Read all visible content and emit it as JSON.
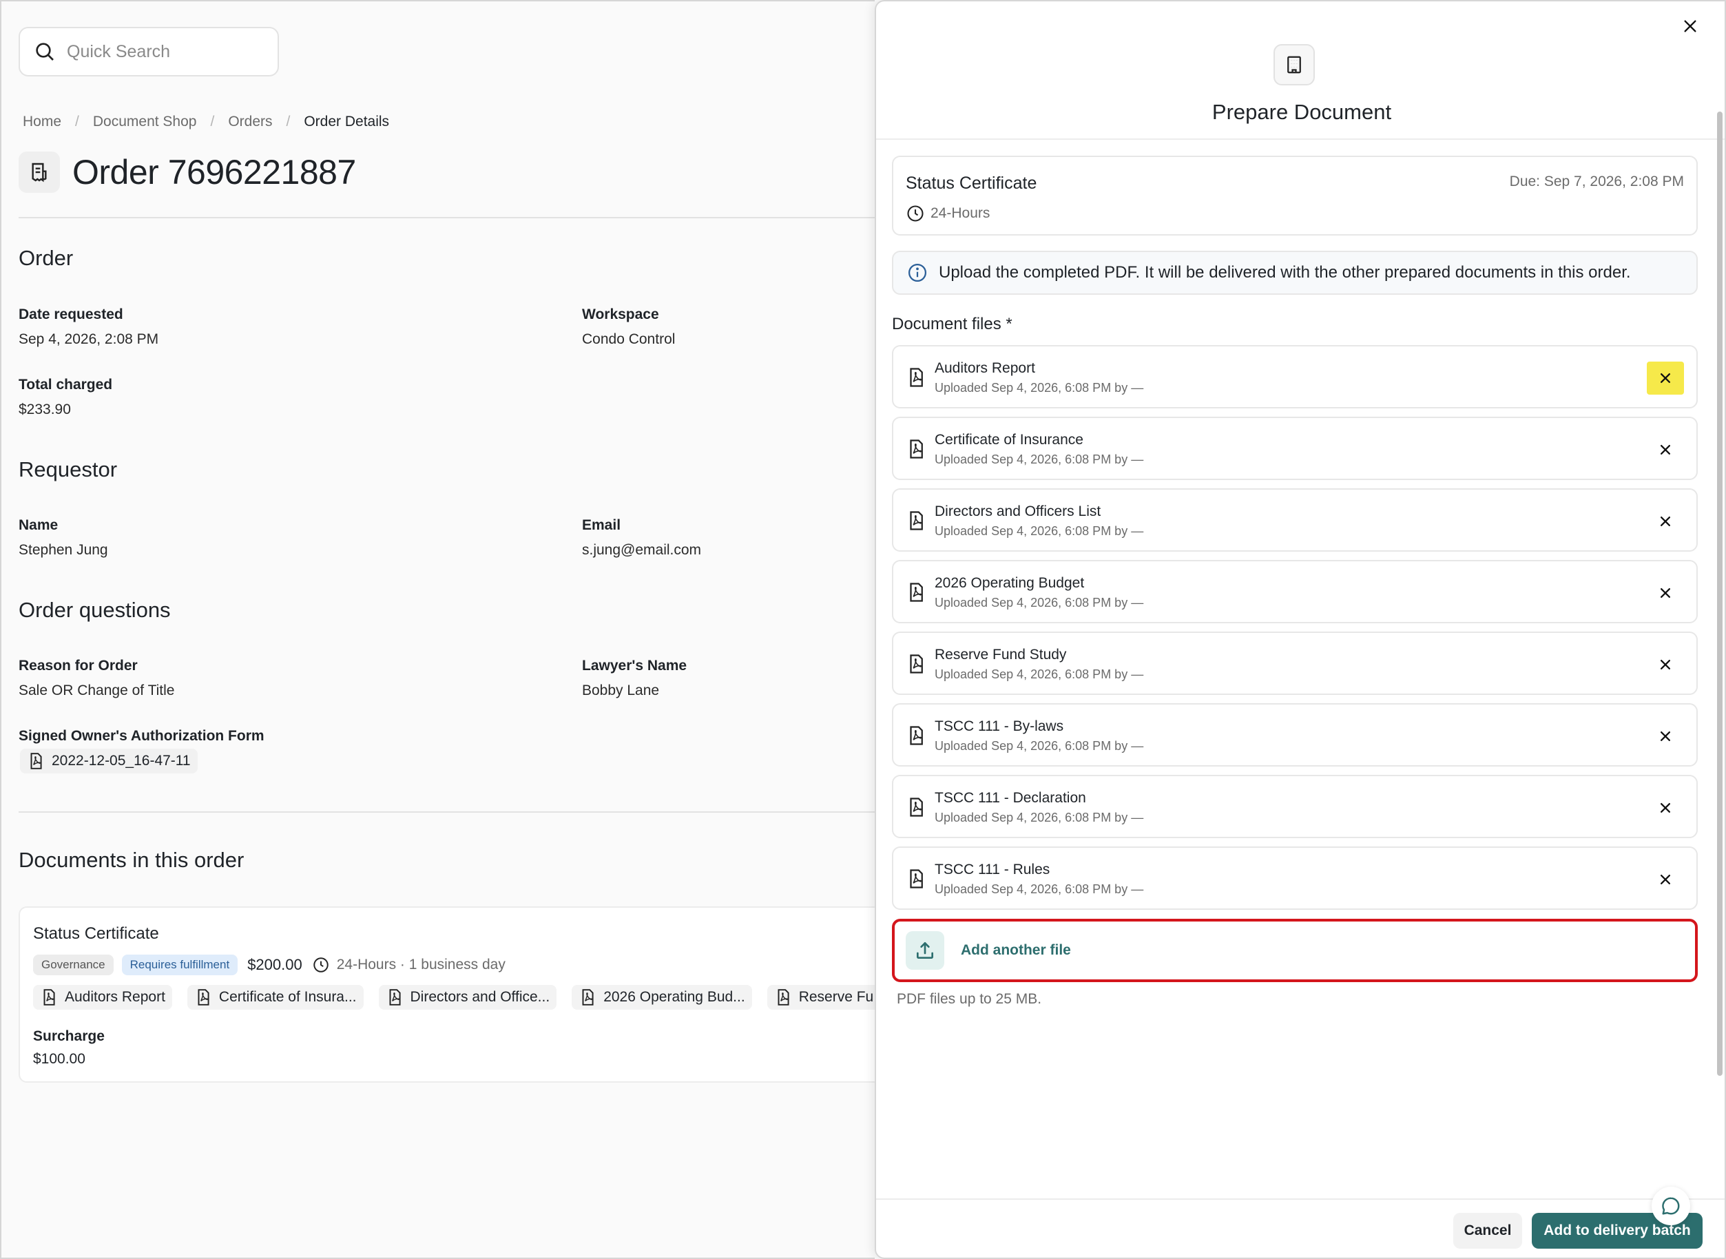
{
  "search": {
    "placeholder": "Quick Search",
    "icon": "search-icon"
  },
  "breadcrumb": [
    "Home",
    "Document Shop",
    "Orders",
    "Order Details"
  ],
  "page": {
    "title": "Order 7696221887",
    "icon": "receipt-icon"
  },
  "order": {
    "heading": "Order",
    "date_requested_label": "Date requested",
    "date_requested": "Sep 4, 2026, 2:08 PM",
    "workspace_label": "Workspace",
    "workspace": "Condo Control",
    "total_charged_label": "Total charged",
    "total_charged": "$233.90"
  },
  "requestor": {
    "heading": "Requestor",
    "name_label": "Name",
    "name": "Stephen Jung",
    "email_label": "Email",
    "email": "s.jung@email.com"
  },
  "order_questions": {
    "heading": "Order questions",
    "reason_label": "Reason for Order",
    "reason": "Sale OR Change of Title",
    "lawyer_label": "Lawyer's Name",
    "lawyer": "Bobby Lane",
    "auth_form_label": "Signed Owner's Authorization Form",
    "auth_form_file": "2022-12-05_16-47-11"
  },
  "documents": {
    "heading": "Documents in this order",
    "card": {
      "title": "Status Certificate",
      "tags": [
        "Governance",
        "Requires fulfillment"
      ],
      "price": "$200.00",
      "turnaround": "24-Hours · 1 business day",
      "files": [
        "Auditors Report",
        "Certificate of Insura...",
        "Directors and Office...",
        "2026 Operating Bud...",
        "Reserve Fu"
      ],
      "surcharge_label": "Surcharge",
      "surcharge": "$100.00"
    }
  },
  "panel": {
    "title": "Prepare Document",
    "icon": "building-icon",
    "doc_name": "Status Certificate",
    "due": "Due: Sep 7, 2026, 2:08 PM",
    "turnaround": "24-Hours",
    "notice": "Upload the completed PDF. It will be delivered with the other prepared documents in this order.",
    "files_label": "Document files *",
    "files": [
      {
        "name": "Auditors Report",
        "meta": "Uploaded Sep 4, 2026, 6:08 PM by —"
      },
      {
        "name": "Certificate of Insurance",
        "meta": "Uploaded Sep 4, 2026, 6:08 PM by —"
      },
      {
        "name": "Directors and Officers List",
        "meta": "Uploaded Sep 4, 2026, 6:08 PM by —"
      },
      {
        "name": "2026 Operating Budget",
        "meta": "Uploaded Sep 4, 2026, 6:08 PM by —"
      },
      {
        "name": "Reserve Fund Study",
        "meta": "Uploaded Sep 4, 2026, 6:08 PM by —"
      },
      {
        "name": "TSCC 111 - By-laws",
        "meta": "Uploaded Sep 4, 2026, 6:08 PM by —"
      },
      {
        "name": "TSCC 111 - Declaration",
        "meta": "Uploaded Sep 4, 2026, 6:08 PM by —"
      },
      {
        "name": "TSCC 111 - Rules",
        "meta": "Uploaded Sep 4, 2026, 6:08 PM by —"
      }
    ],
    "add_file": "Add another file",
    "hint": "PDF files up to 25 MB.",
    "cancel": "Cancel",
    "submit": "Add to delivery batch"
  },
  "colors": {
    "accent": "#2c6e6e",
    "highlight": "#f6e94a",
    "focus_outline": "#d4161c",
    "info": "#2b5f98"
  }
}
